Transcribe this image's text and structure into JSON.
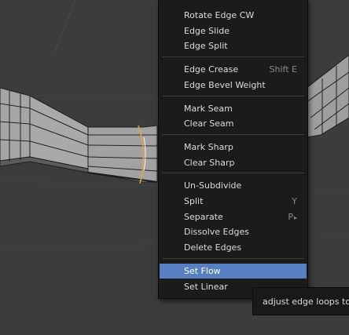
{
  "menu": {
    "groups": [
      {
        "items": [
          {
            "label": "Rotate Edge CW",
            "shortcut": ""
          },
          {
            "label": "Edge Slide",
            "shortcut": ""
          },
          {
            "label": "Edge Split",
            "shortcut": ""
          }
        ]
      },
      {
        "items": [
          {
            "label": "Edge Crease",
            "shortcut": "Shift E"
          },
          {
            "label": "Edge Bevel Weight",
            "shortcut": ""
          }
        ]
      },
      {
        "items": [
          {
            "label": "Mark Seam",
            "shortcut": ""
          },
          {
            "label": "Clear Seam",
            "shortcut": ""
          }
        ]
      },
      {
        "items": [
          {
            "label": "Mark Sharp",
            "shortcut": ""
          },
          {
            "label": "Clear Sharp",
            "shortcut": ""
          }
        ]
      },
      {
        "items": [
          {
            "label": "Un-Subdivide",
            "shortcut": ""
          },
          {
            "label": "Split",
            "shortcut": "Y"
          },
          {
            "label": "Separate",
            "shortcut": "P",
            "submenu_arrow": "▸"
          },
          {
            "label": "Dissolve Edges",
            "shortcut": ""
          },
          {
            "label": "Delete Edges",
            "shortcut": ""
          }
        ]
      },
      {
        "items": [
          {
            "label": "Set Flow",
            "shortcut": "",
            "highlighted": true
          },
          {
            "label": "Set Linear",
            "shortcut": ""
          }
        ]
      }
    ]
  },
  "tooltip": {
    "text": "adjust edge loops to cu"
  },
  "colors": {
    "viewport_bg": "#3c3c3c",
    "menu_bg": "#1b1b1b",
    "highlight": "#5680c2",
    "mesh_face": "#9d9d9d",
    "mesh_edge": "#222222",
    "selected_edge": "#e8a33c"
  }
}
